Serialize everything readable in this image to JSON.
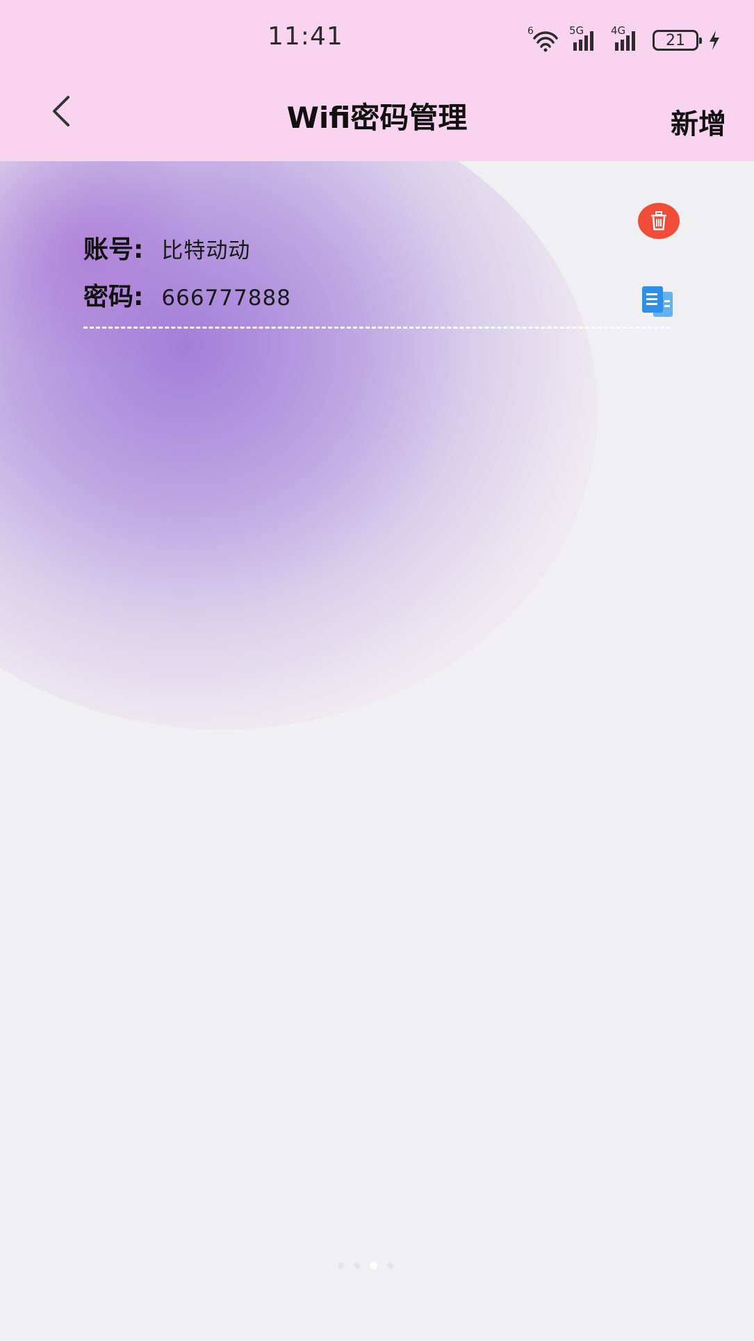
{
  "status_bar": {
    "time": "11:41",
    "battery": "21",
    "wifi_label": "6",
    "signal1_label": "5G",
    "signal2_label": "4G",
    "icons": [
      "wifi-icon",
      "signal-5g-icon",
      "signal-4g-icon",
      "battery-icon",
      "charging-icon"
    ]
  },
  "header": {
    "title": "Wifi密码管理",
    "add_label": "新增",
    "back_icon": "chevron-left-icon",
    "background": "#f8d4ee"
  },
  "entries": [
    {
      "account_label": "账号:",
      "account_value": "比特动动",
      "password_label": "密码:",
      "password_value": "666777888",
      "delete_icon": "trash-icon",
      "copy_icon": "copy-icon"
    }
  ],
  "colors": {
    "accent_purple": "#a078d7",
    "delete_red": "#f04c38",
    "copy_blue": "#2f8fe8",
    "page_bg": "#f0eff1"
  },
  "pager": {
    "count": 4,
    "active_index": 2
  }
}
